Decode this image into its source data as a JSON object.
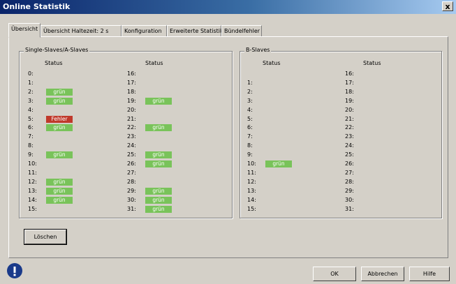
{
  "window": {
    "title": "Online Statistik",
    "close": "x"
  },
  "tabs": [
    "Übersicht",
    "Übersicht  Haltezeit: 2 s",
    "Konfiguration",
    "Erweiterte Statistik",
    "Bündelfehler"
  ],
  "groups": {
    "single": {
      "label": "Single-Slaves/A-Slaves",
      "status_header": "Status"
    },
    "b": {
      "label": "B-Slaves",
      "status_header": "Status"
    }
  },
  "single_left": [
    {
      "n": "0:",
      "s": ""
    },
    {
      "n": "1:",
      "s": ""
    },
    {
      "n": "2:",
      "s": "grün"
    },
    {
      "n": "3:",
      "s": "grün"
    },
    {
      "n": "4:",
      "s": ""
    },
    {
      "n": "5:",
      "s": "Fehler",
      "err": true
    },
    {
      "n": "6:",
      "s": "grün"
    },
    {
      "n": "7:",
      "s": ""
    },
    {
      "n": "8:",
      "s": ""
    },
    {
      "n": "9:",
      "s": "grün"
    },
    {
      "n": "10:",
      "s": ""
    },
    {
      "n": "11:",
      "s": ""
    },
    {
      "n": "12:",
      "s": "grün"
    },
    {
      "n": "13:",
      "s": "grün"
    },
    {
      "n": "14:",
      "s": "grün"
    },
    {
      "n": "15:",
      "s": ""
    }
  ],
  "single_right": [
    {
      "n": "16:",
      "s": ""
    },
    {
      "n": "17:",
      "s": ""
    },
    {
      "n": "18:",
      "s": ""
    },
    {
      "n": "19:",
      "s": "grün"
    },
    {
      "n": "20:",
      "s": ""
    },
    {
      "n": "21:",
      "s": ""
    },
    {
      "n": "22:",
      "s": "grün"
    },
    {
      "n": "23:",
      "s": ""
    },
    {
      "n": "24:",
      "s": ""
    },
    {
      "n": "25:",
      "s": "grün"
    },
    {
      "n": "26:",
      "s": "grün"
    },
    {
      "n": "27:",
      "s": ""
    },
    {
      "n": "28:",
      "s": ""
    },
    {
      "n": "29:",
      "s": "grün"
    },
    {
      "n": "30:",
      "s": "grün"
    },
    {
      "n": "31:",
      "s": "grün"
    }
  ],
  "b_left": [
    {
      "n": "",
      "s": ""
    },
    {
      "n": "1:",
      "s": ""
    },
    {
      "n": "2:",
      "s": ""
    },
    {
      "n": "3:",
      "s": ""
    },
    {
      "n": "4:",
      "s": ""
    },
    {
      "n": "5:",
      "s": ""
    },
    {
      "n": "6:",
      "s": ""
    },
    {
      "n": "7:",
      "s": ""
    },
    {
      "n": "8:",
      "s": ""
    },
    {
      "n": "9:",
      "s": ""
    },
    {
      "n": "10:",
      "s": "grün"
    },
    {
      "n": "11:",
      "s": ""
    },
    {
      "n": "12:",
      "s": ""
    },
    {
      "n": "13:",
      "s": ""
    },
    {
      "n": "14:",
      "s": ""
    },
    {
      "n": "15:",
      "s": ""
    }
  ],
  "b_right": [
    {
      "n": "16:",
      "s": ""
    },
    {
      "n": "17:",
      "s": ""
    },
    {
      "n": "18:",
      "s": ""
    },
    {
      "n": "19:",
      "s": ""
    },
    {
      "n": "20:",
      "s": ""
    },
    {
      "n": "21:",
      "s": ""
    },
    {
      "n": "22:",
      "s": ""
    },
    {
      "n": "23:",
      "s": ""
    },
    {
      "n": "24:",
      "s": ""
    },
    {
      "n": "25:",
      "s": ""
    },
    {
      "n": "26:",
      "s": ""
    },
    {
      "n": "27:",
      "s": ""
    },
    {
      "n": "28:",
      "s": ""
    },
    {
      "n": "29:",
      "s": ""
    },
    {
      "n": "30:",
      "s": ""
    },
    {
      "n": "31:",
      "s": ""
    }
  ],
  "buttons": {
    "loeschen": "Löschen",
    "ok": "OK",
    "abbrechen": "Abbrechen",
    "hilfe": "Hilfe"
  },
  "colors": {
    "ok": "#79c35a",
    "error": "#c0392b",
    "titlebar": "#0a246a"
  }
}
